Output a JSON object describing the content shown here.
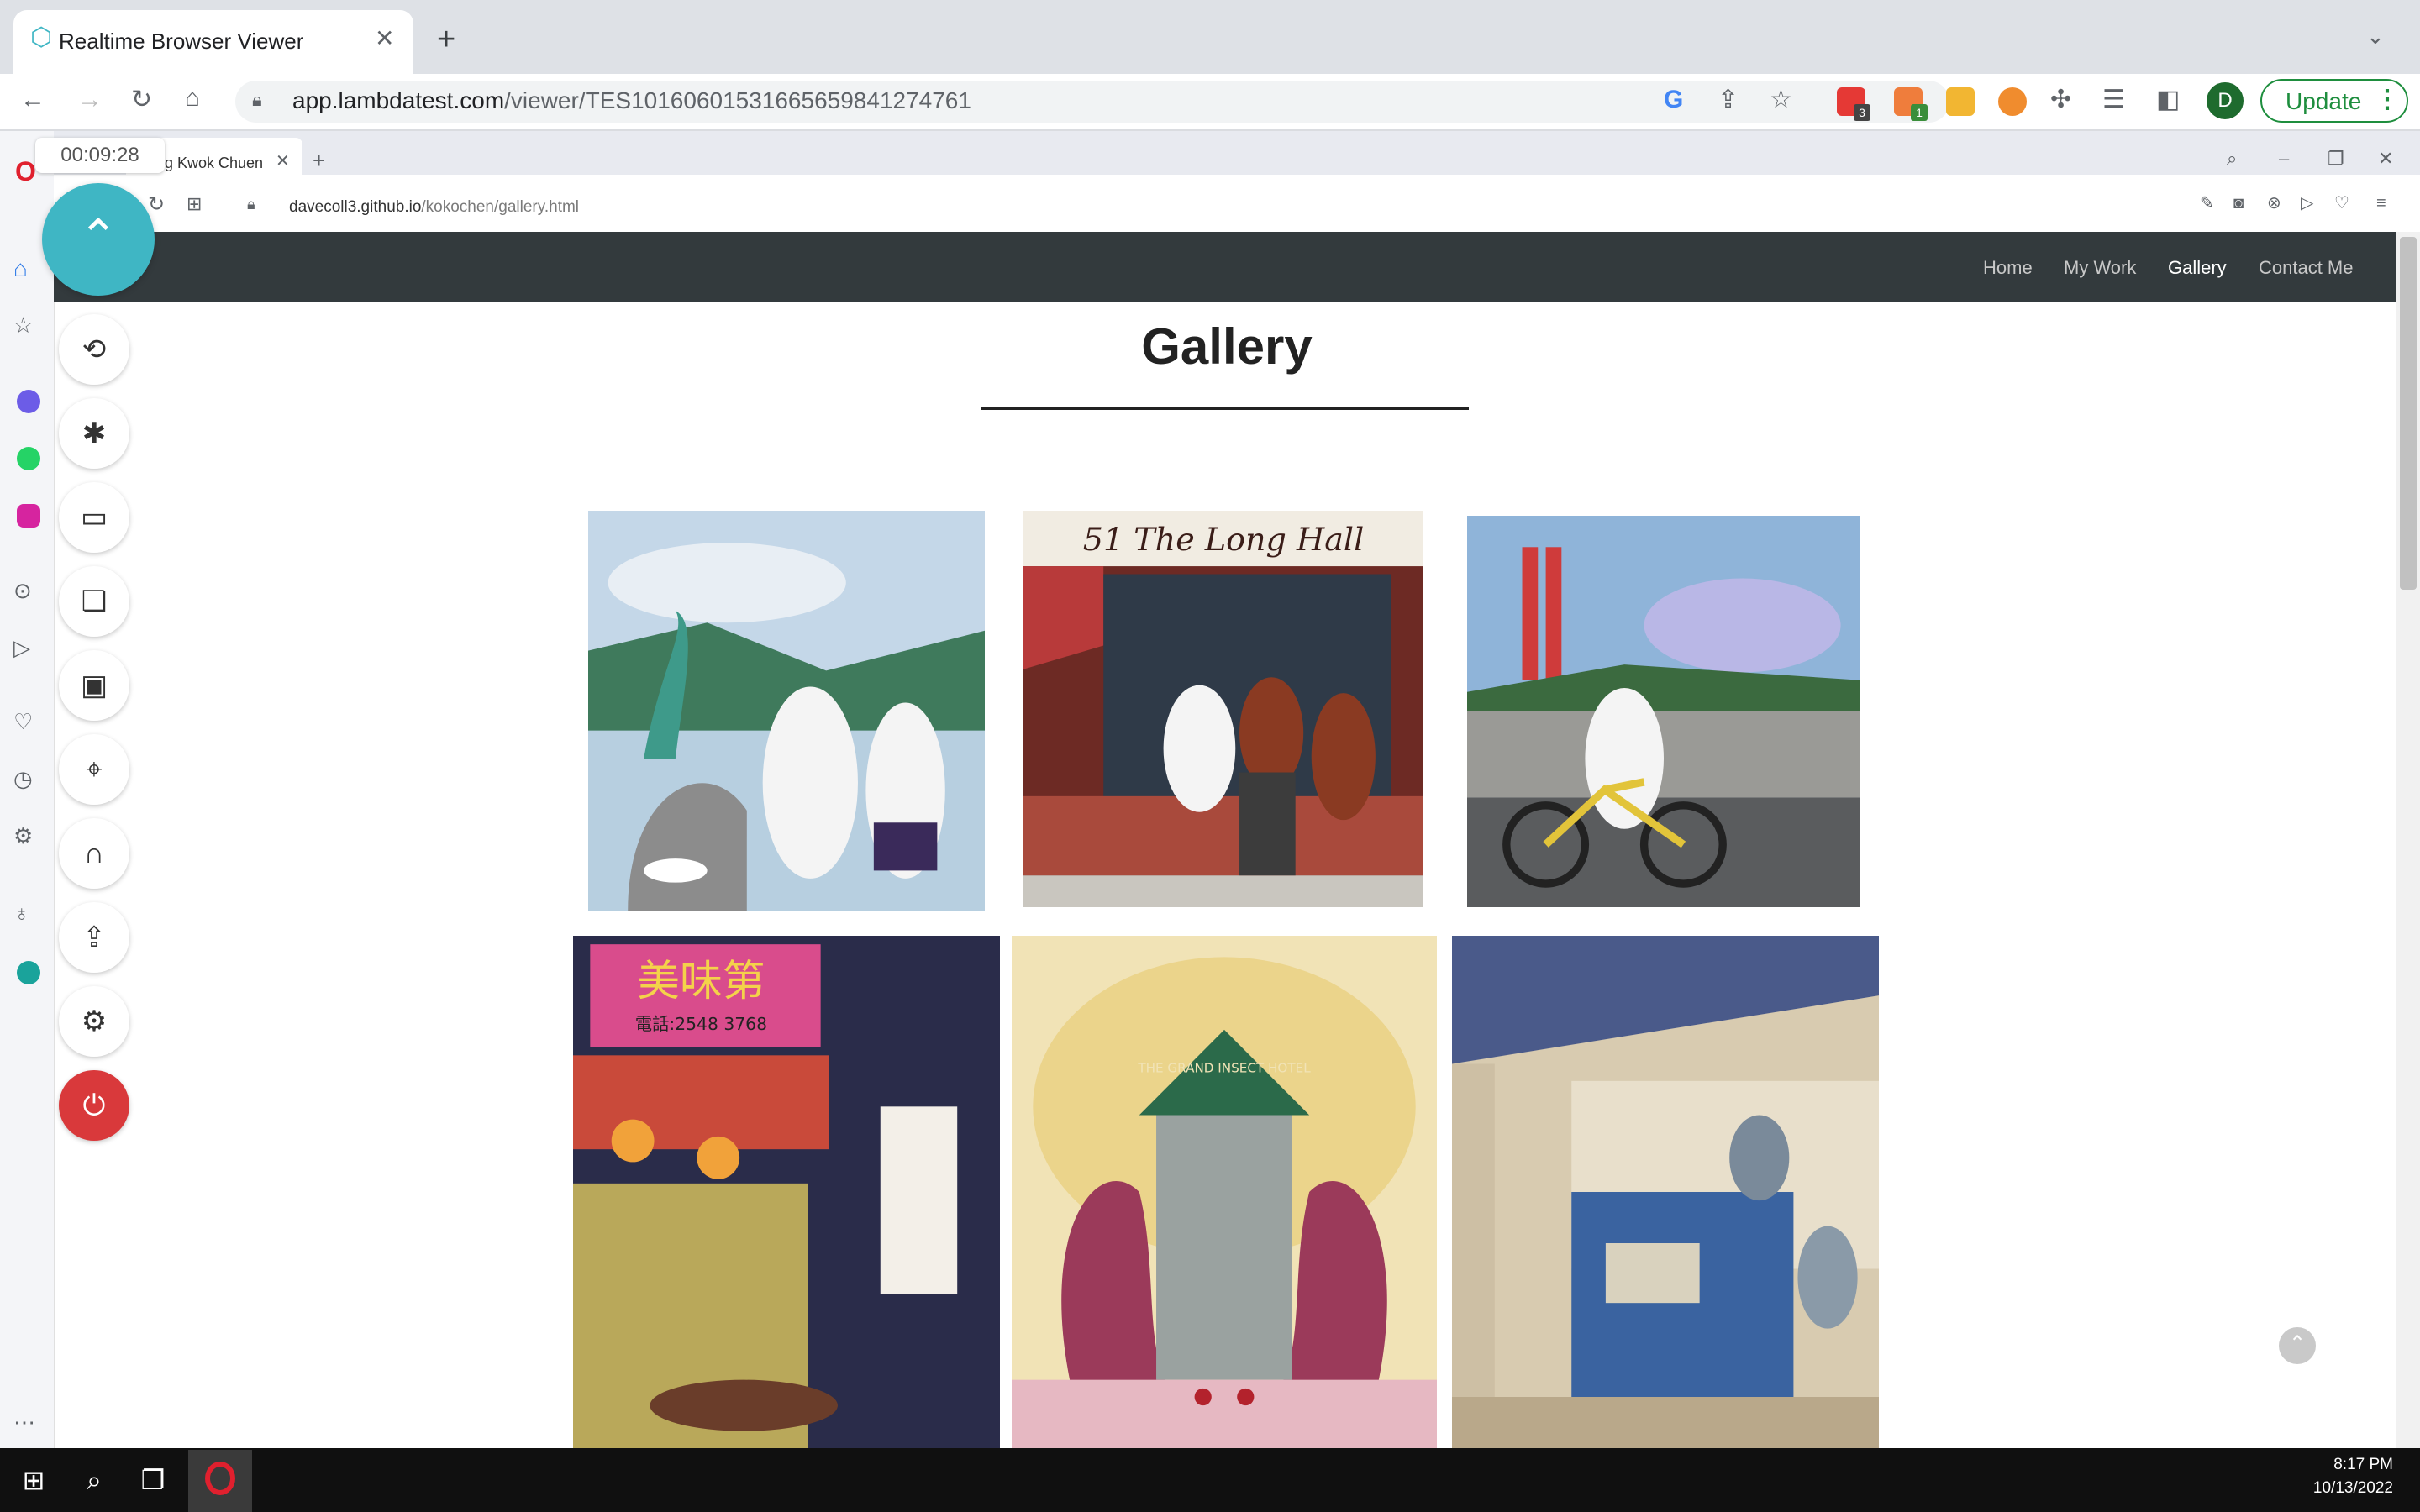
{
  "chrome": {
    "tab_title": "Realtime Browser Viewer",
    "url_host": "app.lambdatest.com",
    "url_path": "/viewer/TES10160601531665659841274761",
    "update_label": "Update",
    "avatar_letter": "D",
    "ext_badges": [
      "3",
      "1"
    ]
  },
  "remote": {
    "timer": "00:09:28",
    "tab_title": "g Kwok Chuen",
    "url_host": "davecoll3.github.io",
    "url_path": "/kokochen/gallery.html"
  },
  "site": {
    "nav": [
      "Home",
      "My Work",
      "Gallery",
      "Contact Me"
    ],
    "active_nav": "Gallery",
    "title": "Gallery",
    "artwork_text": {
      "longhall": "51  The Long Hall",
      "hk_sign": "美味第",
      "hk_phone": "電話:2548 3768",
      "hotel": "THE GRAND INSECT HOTEL"
    }
  },
  "taskbar": {
    "time": "8:17 PM",
    "date": "10/13/2022"
  }
}
